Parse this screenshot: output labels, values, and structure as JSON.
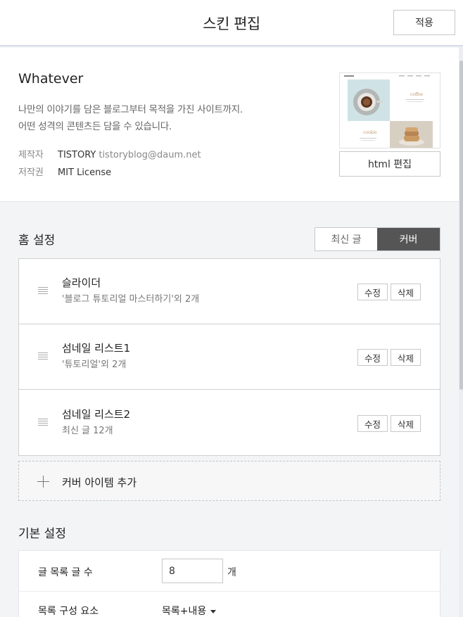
{
  "header": {
    "title": "스킨 편집",
    "apply_label": "적용"
  },
  "skin": {
    "name": "Whatever",
    "desc_line1": "나만의 이야기를 담은 블로그부터 목적을 가진 사이트까지.",
    "desc_line2": "어떤 성격의 콘텐츠든 담을 수 있습니다.",
    "author_label": "제작자",
    "author_name": "TISTORY",
    "author_email": "tistoryblog@daum.net",
    "license_label": "저작권",
    "license_value": "MIT License",
    "html_edit_label": "html 편집",
    "thumb_coffee": "coffee",
    "thumb_cookie": "cookie"
  },
  "home": {
    "title": "홈 설정",
    "tab_recent": "최신 글",
    "tab_cover": "커버",
    "items": [
      {
        "title": "슬라이더",
        "sub": "'블로그 튜토리얼 마스터하기'외 2개",
        "edit": "수정",
        "delete": "삭제"
      },
      {
        "title": "섬네일 리스트1",
        "sub": "'튜토리얼'외 2개",
        "edit": "수정",
        "delete": "삭제"
      },
      {
        "title": "섬네일 리스트2",
        "sub": "최신 글 12개",
        "edit": "수정",
        "delete": "삭제"
      }
    ],
    "add_label": "커버 아이템 추가"
  },
  "basic": {
    "title": "기본 설정",
    "post_count_label": "글 목록 글 수",
    "post_count_value": "8",
    "post_count_unit": "개",
    "list_comp_label": "목록 구성 요소",
    "list_comp_value": "목록+내용"
  },
  "colors": {
    "segment_active": "#555555",
    "background": "#f3f4f6",
    "header_border": "#d5dbe6"
  }
}
